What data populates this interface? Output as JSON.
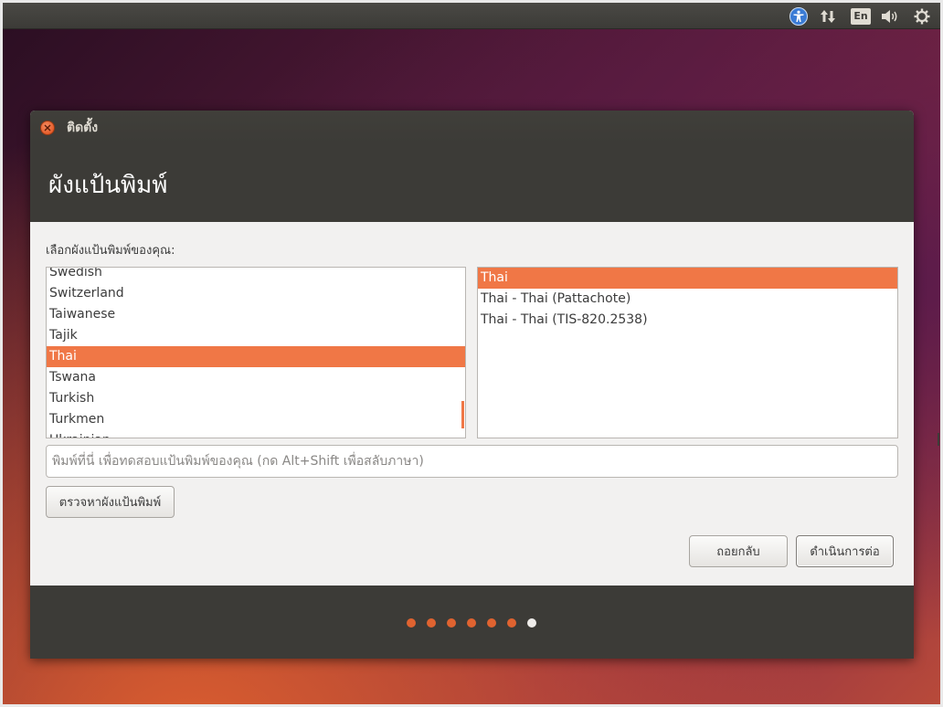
{
  "top_panel": {
    "indicators": [
      {
        "name": "accessibility-icon"
      },
      {
        "name": "network-updown-icon"
      },
      {
        "name": "keyboard-indicator",
        "label": "En"
      },
      {
        "name": "sound-icon"
      },
      {
        "name": "gear-icon"
      }
    ],
    "keyboard_label": "En"
  },
  "window": {
    "title": "ติดตั้ง",
    "page_title": "ผังแป้นพิมพ์"
  },
  "content": {
    "prompt": "เลือกผังแป้นพิมพ์ของคุณ:",
    "layouts": [
      {
        "label": "Swedish",
        "selected": false
      },
      {
        "label": "Switzerland",
        "selected": false
      },
      {
        "label": "Taiwanese",
        "selected": false
      },
      {
        "label": "Tajik",
        "selected": false
      },
      {
        "label": "Thai",
        "selected": true
      },
      {
        "label": "Tswana",
        "selected": false
      },
      {
        "label": "Turkish",
        "selected": false
      },
      {
        "label": "Turkmen",
        "selected": false
      },
      {
        "label": "Ukrainian",
        "selected": false
      }
    ],
    "variants": [
      {
        "label": "Thai",
        "selected": true
      },
      {
        "label": "Thai - Thai (Pattachote)",
        "selected": false
      },
      {
        "label": "Thai - Thai (TIS-820.2538)",
        "selected": false
      }
    ],
    "test_input": {
      "value": "",
      "placeholder": "พิมพ์ที่นี่ เพื่อทดสอบแป้นพิมพ์ของคุณ (กด Alt+Shift เพื่อสลับภาษา)"
    },
    "detect_button": "ตรวจหาผังแป้นพิมพ์",
    "back_button": "ถอยกลับ",
    "continue_button": "ดำเนินการต่อ"
  },
  "progress": {
    "total_steps": 7,
    "current_step": 7
  },
  "colors": {
    "accent": "#f07746",
    "dot_done": "#e06330",
    "dot_current": "#efedea",
    "panel": "#3c3b37"
  }
}
